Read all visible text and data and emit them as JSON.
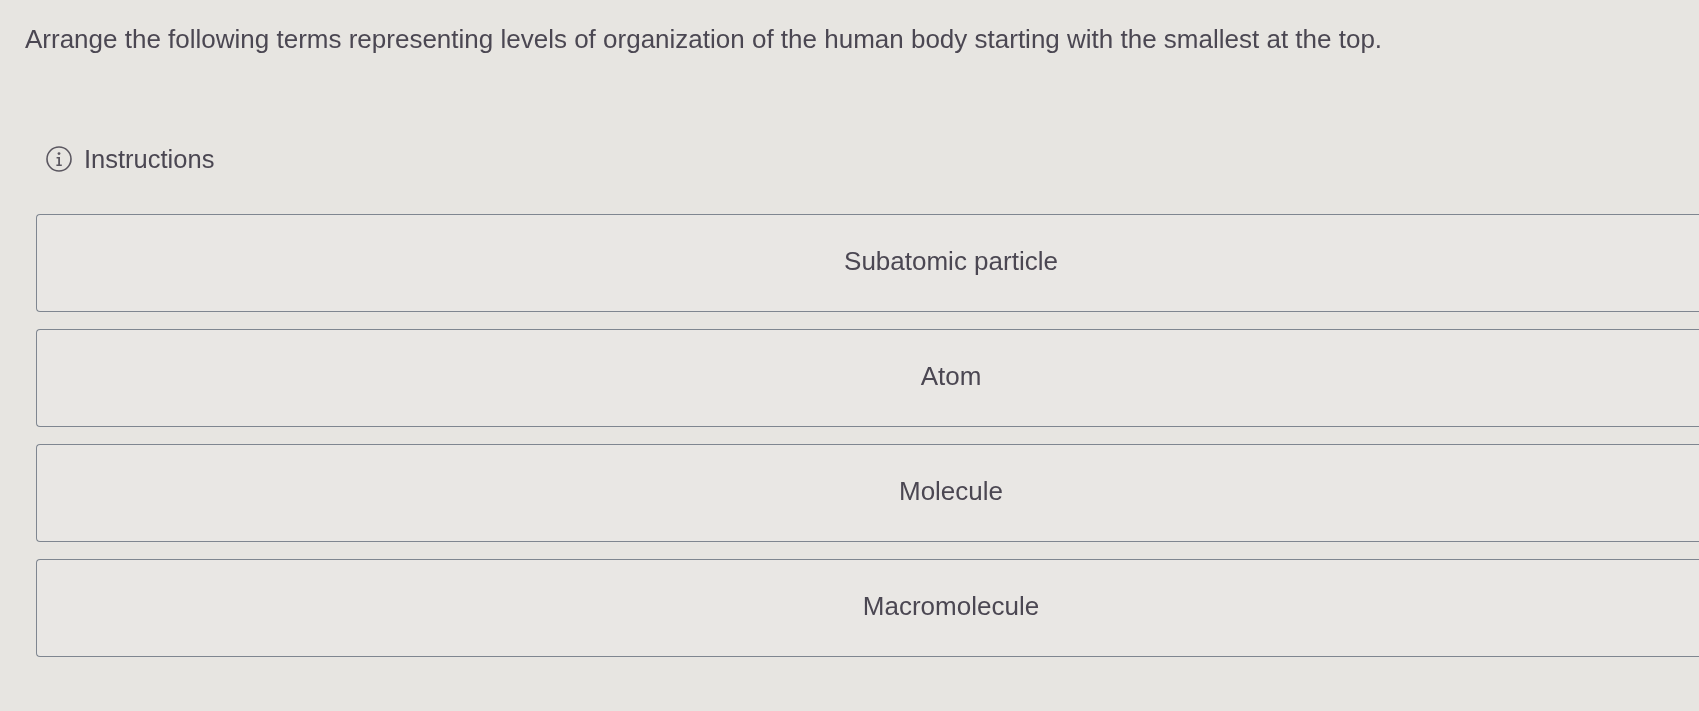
{
  "question": "Arrange the following terms representing levels of organization of the human body starting with the smallest at the top.",
  "instructions": {
    "label": "Instructions"
  },
  "items": [
    {
      "label": "Subatomic particle"
    },
    {
      "label": "Atom"
    },
    {
      "label": "Molecule"
    },
    {
      "label": "Macromolecule"
    }
  ]
}
